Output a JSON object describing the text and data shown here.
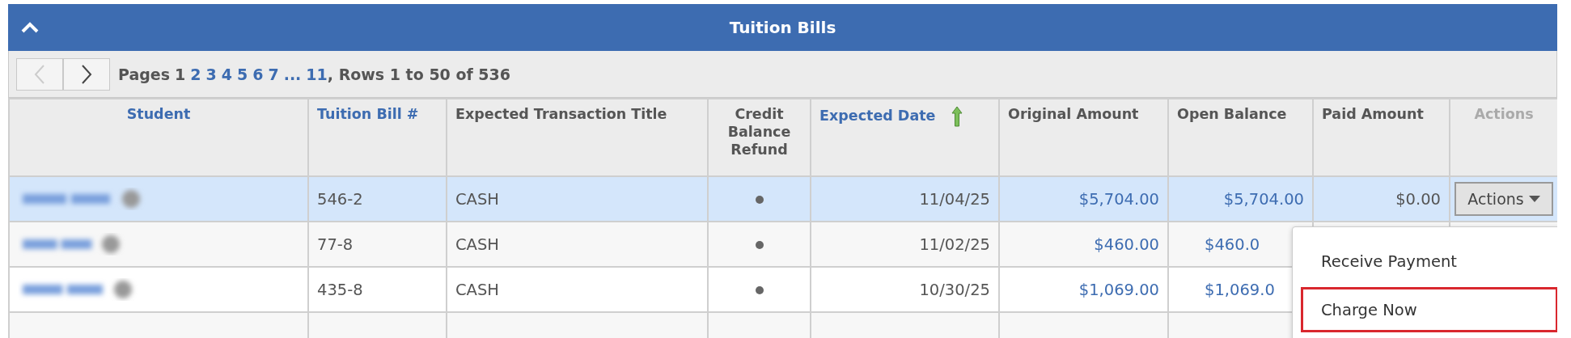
{
  "panel": {
    "title": "Tuition Bills",
    "expanded": true
  },
  "pager": {
    "prefix": "Pages",
    "pages": [
      {
        "label": "1",
        "selected": true
      },
      {
        "label": "2",
        "selected": false
      },
      {
        "label": "3",
        "selected": false
      },
      {
        "label": "4",
        "selected": false
      },
      {
        "label": "5",
        "selected": false
      },
      {
        "label": "6",
        "selected": false
      },
      {
        "label": "7",
        "selected": false
      },
      {
        "label": "...",
        "selected": false
      },
      {
        "label": "11",
        "selected": false
      }
    ],
    "summary": ", Rows 1 to 50 of 536",
    "prev_disabled": true
  },
  "table": {
    "columns": [
      {
        "label": "Student",
        "kind": "link"
      },
      {
        "label": "Tuition Bill #",
        "kind": "link"
      },
      {
        "label": "Expected Transaction Title",
        "kind": "plain"
      },
      {
        "label": "Credit Balance Refund",
        "kind": "plain"
      },
      {
        "label": "Expected Date",
        "kind": "link",
        "sorted_ascending": true
      },
      {
        "label": "Original Amount",
        "kind": "plain"
      },
      {
        "label": "Open Balance",
        "kind": "plain"
      },
      {
        "label": "Paid Amount",
        "kind": "plain"
      },
      {
        "label": "Actions",
        "kind": "disabled"
      }
    ],
    "rows": [
      {
        "selected": true,
        "bill": "546-2",
        "title": "CASH",
        "credit_refund": false,
        "date": "11/04/25",
        "original": "$5,704.00",
        "open": "$5,704.00",
        "paid": "$0.00",
        "action": "Actions"
      },
      {
        "selected": false,
        "bill": "77-8",
        "title": "CASH",
        "credit_refund": false,
        "date": "11/02/25",
        "original": "$460.00",
        "open": "$460.0"
      },
      {
        "selected": false,
        "bill": "435-8",
        "title": "CASH",
        "credit_refund": false,
        "date": "10/30/25",
        "original": "$1,069.00",
        "open": "$1,069.0"
      }
    ]
  },
  "menu": {
    "items": [
      {
        "label": "Receive Payment",
        "highlighted": false
      },
      {
        "label": "Charge Now",
        "highlighted": true
      }
    ]
  }
}
